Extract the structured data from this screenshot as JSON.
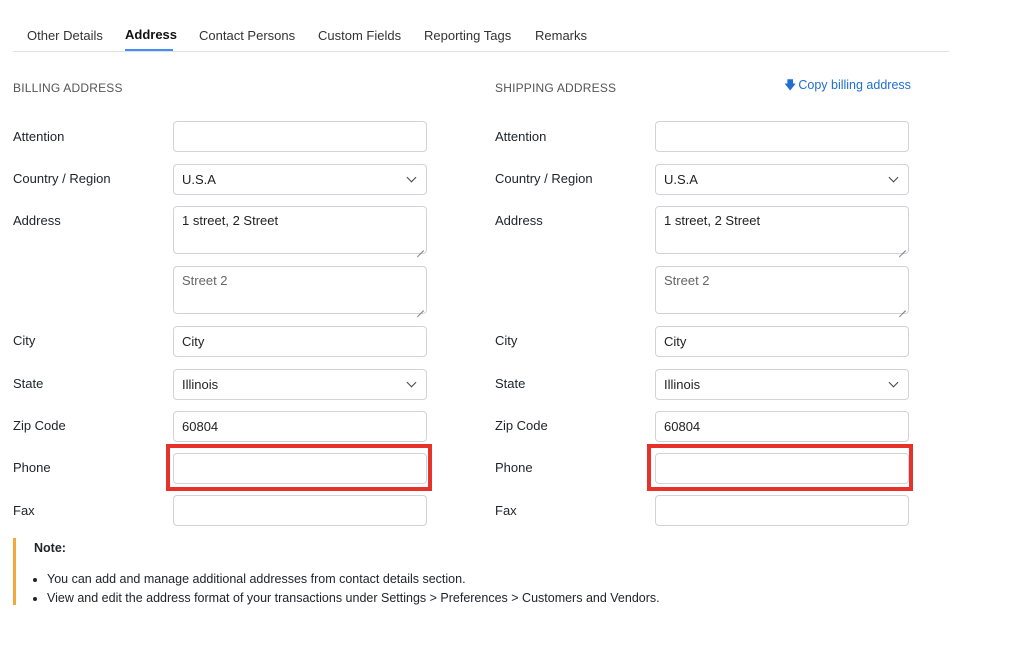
{
  "tabs": [
    {
      "label": "Other Details",
      "active": false
    },
    {
      "label": "Address",
      "active": true
    },
    {
      "label": "Contact Persons",
      "active": false
    },
    {
      "label": "Custom Fields",
      "active": false
    },
    {
      "label": "Reporting Tags",
      "active": false
    },
    {
      "label": "Remarks",
      "active": false
    }
  ],
  "billing": {
    "title": "BILLING ADDRESS",
    "labels": {
      "attention": "Attention",
      "country": "Country / Region",
      "address": "Address",
      "city": "City",
      "state": "State",
      "zip": "Zip Code",
      "phone": "Phone",
      "fax": "Fax"
    },
    "attention": "",
    "country": "U.S.A",
    "address1": "1 street, 2 Street",
    "street2_placeholder": "Street 2",
    "city": "City",
    "state": "Illinois",
    "zip": "60804",
    "phone": "",
    "fax": ""
  },
  "shipping": {
    "title": "SHIPPING ADDRESS",
    "copy_label": "Copy billing address",
    "copy_icon": "download-arrow-icon",
    "labels": {
      "attention": "Attention",
      "country": "Country / Region",
      "address": "Address",
      "city": "City",
      "state": "State",
      "zip": "Zip Code",
      "phone": "Phone",
      "fax": "Fax"
    },
    "attention": "",
    "country": "U.S.A",
    "address1": "1 street, 2 Street",
    "street2_placeholder": "Street 2",
    "city": "City",
    "state": "Illinois",
    "zip": "60804",
    "phone": "",
    "fax": ""
  },
  "note": {
    "title": "Note:",
    "items": [
      "You can add and manage additional addresses from contact details section.",
      "View and edit the address format of your transactions under Settings > Preferences > Customers and Vendors."
    ]
  },
  "colors": {
    "accent": "#408dfb",
    "link": "#1f6fd1",
    "highlight": "#e5322b",
    "note_bar": "#f0a93b"
  }
}
